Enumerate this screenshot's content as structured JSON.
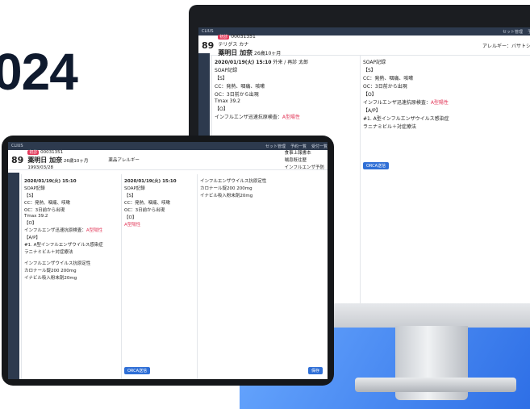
{
  "watermark_year": "024",
  "app": {
    "logo": "CLIUS",
    "menu": [
      "セット管理",
      "予約一覧",
      "受付一覧"
    ]
  },
  "patient": {
    "age": "89",
    "id": "00031351",
    "kana": "テリグス カナ",
    "name": "薬明日 加奈",
    "age_detail": "26歳10ヶ月",
    "birth": "1993/03/28",
    "tag": "初診"
  },
  "allergy": {
    "label": "アレルギー：バサトシン薬",
    "tag": "薬品アレルギー"
  },
  "right_info": [
    "食事上報書本",
    "喘息既往歴",
    "インフルエンザ予防"
  ],
  "record": {
    "datetime": "2020/01/19(火) 15:10",
    "meta": "外来 / 再診 太郎",
    "date": "2020/01/19(火)"
  },
  "soap": {
    "s_label": "【S】",
    "s_lines": [
      "CC：発熱、咽痛、咳嗽",
      "OC：3日前から出現",
      "Tmax 39.2"
    ],
    "o_label": "【O】",
    "o_line": "インフルエンザ迅速抗原検査：",
    "o_result": "A型陽性",
    "p_label": "【A/P】",
    "p_lines": [
      "#1. A型インフルエンザウイルス感染症",
      "ラニナミビル＋対症療法"
    ]
  },
  "orders": [
    "インフルエンザウイルス抗原定性",
    "カロナール錠200 200mg",
    "イナビル吸入粉末剤20mg"
  ],
  "buttons": {
    "submit": "ORCA送信",
    "save": "保存"
  },
  "header_label": "SOAP記録"
}
